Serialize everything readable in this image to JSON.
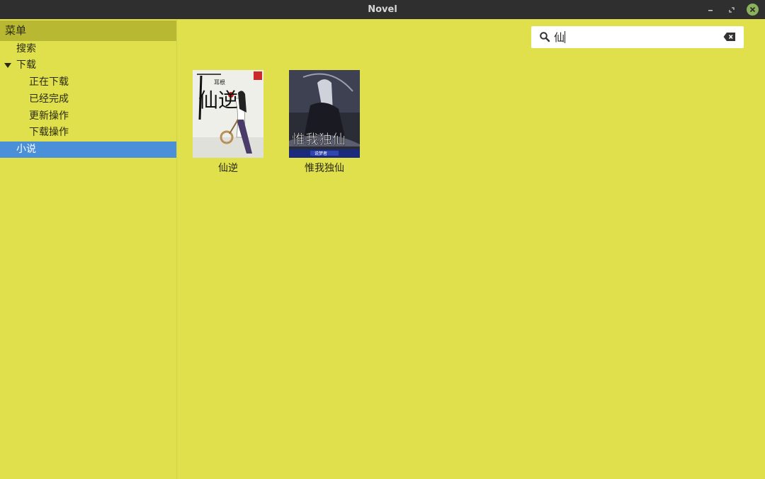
{
  "window": {
    "title": "Novel"
  },
  "sidebar": {
    "header": "菜单",
    "items": [
      {
        "label": "搜索"
      },
      {
        "label": "下载"
      },
      {
        "label": "正在下载"
      },
      {
        "label": "已经完成"
      },
      {
        "label": "更新操作"
      },
      {
        "label": "下载操作"
      },
      {
        "label": "小说"
      }
    ]
  },
  "search": {
    "value": "仙",
    "placeholder": ""
  },
  "books": [
    {
      "title": "仙逆",
      "cover_text": "仙逆",
      "cover_author": "耳根"
    },
    {
      "title": "惟我独仙",
      "cover_text": "惟我独仙",
      "cover_author": "说梦者"
    }
  ],
  "colors": {
    "background": "#dfe04b",
    "sidebar_header": "#b8b833",
    "selection": "#4a90d9",
    "titlebar": "#2f2f2f"
  }
}
